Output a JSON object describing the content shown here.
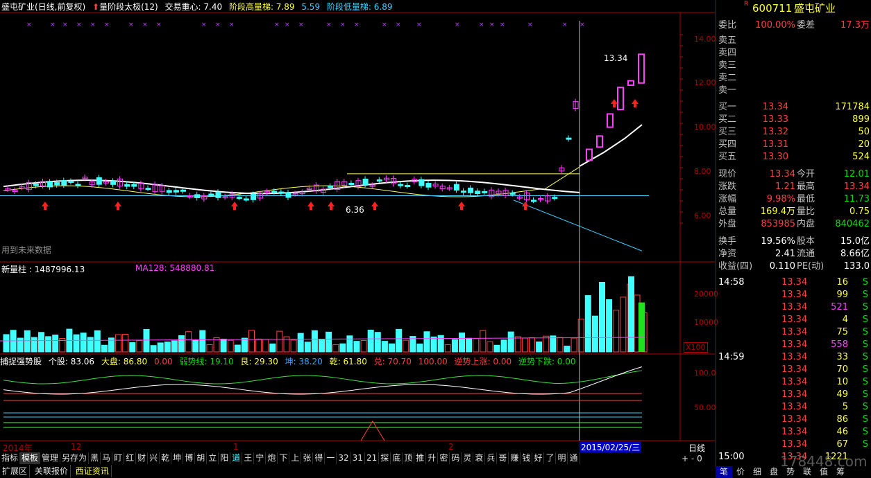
{
  "header": {
    "title": "盛屯矿业(日线,前复权)",
    "ind1_label": "量阶段太极(12)",
    "ind2": "交易重心: 7.40",
    "ind3": "阶段高量梯: 7.89",
    "ind4": "5.59",
    "ind5": "阶段低量梯: 6.89"
  },
  "price_axis": [
    "14.00",
    "12.00",
    "10.00",
    "8.00",
    "6.00"
  ],
  "main_notes": {
    "future_data": "用到未来数据",
    "high_label": "13.34",
    "low_label": "6.36"
  },
  "vol_header": {
    "label": "新量柱 : 1487996.13",
    "ma": "MA128: 548880.81"
  },
  "vol_axis": [
    "20000",
    "10000"
  ],
  "vol_unit": "X100",
  "ind_header": {
    "name": "捕捉强势股",
    "items": [
      "个股: 83.06",
      "大盘: 86.80",
      "0.00",
      "弱势线: 19.10",
      "艮: 29.30",
      "坤: 38.20",
      "乾: 61.80",
      "兑: 70.70",
      "100.00",
      "逆势上涨: 0.00",
      "逆势下跌: 0.00"
    ]
  },
  "ind_axis": [
    "100.0",
    "50.00"
  ],
  "date_axis": {
    "d1": "2014年",
    "d2": "12",
    "d3": "1",
    "d4": "2",
    "current": "2015/02/25/三",
    "period": "日线"
  },
  "quote": {
    "code": "600711",
    "name": "盛屯矿业",
    "webi_label": "委比",
    "webi": "100.00%",
    "wecha_label": "委差",
    "wecha": "17.3万",
    "sell": [
      {
        "l": "卖五",
        "p": "",
        "v": ""
      },
      {
        "l": "卖四",
        "p": "",
        "v": ""
      },
      {
        "l": "卖三",
        "p": "",
        "v": ""
      },
      {
        "l": "卖二",
        "p": "",
        "v": ""
      },
      {
        "l": "卖一",
        "p": "",
        "v": ""
      }
    ],
    "buy": [
      {
        "l": "买一",
        "p": "13.34",
        "v": "171784"
      },
      {
        "l": "买二",
        "p": "13.33",
        "v": "899"
      },
      {
        "l": "买三",
        "p": "13.32",
        "v": "50"
      },
      {
        "l": "买四",
        "p": "13.31",
        "v": "20"
      },
      {
        "l": "买五",
        "p": "13.30",
        "v": "524"
      }
    ],
    "stats": [
      {
        "k": "现价",
        "v": "13.34",
        "k2": "今开",
        "v2": "12.01"
      },
      {
        "k": "涨跌",
        "v": "1.21",
        "k2": "最高",
        "v2": "13.34"
      },
      {
        "k": "涨幅",
        "v": "9.98%",
        "k2": "最低",
        "v2": "11.73"
      },
      {
        "k": "总量",
        "v": "169.4万",
        "k2": "量比",
        "v2": "0.75"
      },
      {
        "k": "外盘",
        "v": "853985",
        "k2": "内盘",
        "v2": "840462"
      }
    ],
    "stats2": [
      {
        "k": "换手",
        "v": "19.56%",
        "k2": "股本",
        "v2": "15.0亿"
      },
      {
        "k": "净资",
        "v": "2.41",
        "k2": "流通",
        "v2": "8.66亿"
      },
      {
        "k": "收益(四)",
        "v": "0.110",
        "k2": "PE(动)",
        "v2": "133.0"
      }
    ],
    "ticks": [
      {
        "t": "14:58",
        "p": "13.34",
        "q": "16",
        "s": "S"
      },
      {
        "t": "",
        "p": "13.34",
        "q": "99",
        "s": "S"
      },
      {
        "t": "",
        "p": "13.34",
        "q": "521",
        "s": "S"
      },
      {
        "t": "",
        "p": "13.34",
        "q": "4",
        "s": "S"
      },
      {
        "t": "",
        "p": "13.34",
        "q": "75",
        "s": "S"
      },
      {
        "t": "",
        "p": "13.34",
        "q": "558",
        "s": "S"
      },
      {
        "t": "14:59",
        "p": "13.34",
        "q": "33",
        "s": "S"
      },
      {
        "t": "",
        "p": "13.34",
        "q": "70",
        "s": "S"
      },
      {
        "t": "",
        "p": "13.34",
        "q": "10",
        "s": "S"
      },
      {
        "t": "",
        "p": "13.34",
        "q": "49",
        "s": "S"
      },
      {
        "t": "",
        "p": "13.34",
        "q": "5",
        "s": "S"
      },
      {
        "t": "",
        "p": "13.34",
        "q": "86",
        "s": "S"
      },
      {
        "t": "",
        "p": "13.34",
        "q": "46",
        "s": "S"
      },
      {
        "t": "",
        "p": "13.34",
        "q": "67",
        "s": "S"
      },
      {
        "t": "15:00",
        "p": "13.34",
        "q": "1221",
        "s": ""
      }
    ]
  },
  "tabs": [
    "指标",
    "模板",
    "管理",
    "另存为",
    "黑",
    "马",
    "盯",
    "红",
    "财",
    "兴",
    "乾",
    "坤",
    "博",
    "胡",
    "立",
    "阳",
    "道",
    "王",
    "宁",
    "炮",
    "下",
    "上",
    "张",
    "得",
    "一",
    "32",
    "31",
    "21",
    "探",
    "底",
    "顶",
    "推",
    "升",
    "密",
    "码",
    "灵",
    "衰",
    "兵",
    "哥",
    "赚",
    "钱",
    "好",
    "了",
    "明",
    "通"
  ],
  "tabs_active": "模板",
  "bottom_links": [
    "扩展区",
    "关联报价",
    "西证资讯"
  ],
  "right_bottom": [
    "笔",
    "价",
    "细",
    "盘",
    "势",
    "联",
    "值",
    "筹"
  ],
  "watermark": "178448.com",
  "zoom_plus": "+",
  "zoom_minus": "-",
  "zoom_zero": "0",
  "flag_r": "R"
}
